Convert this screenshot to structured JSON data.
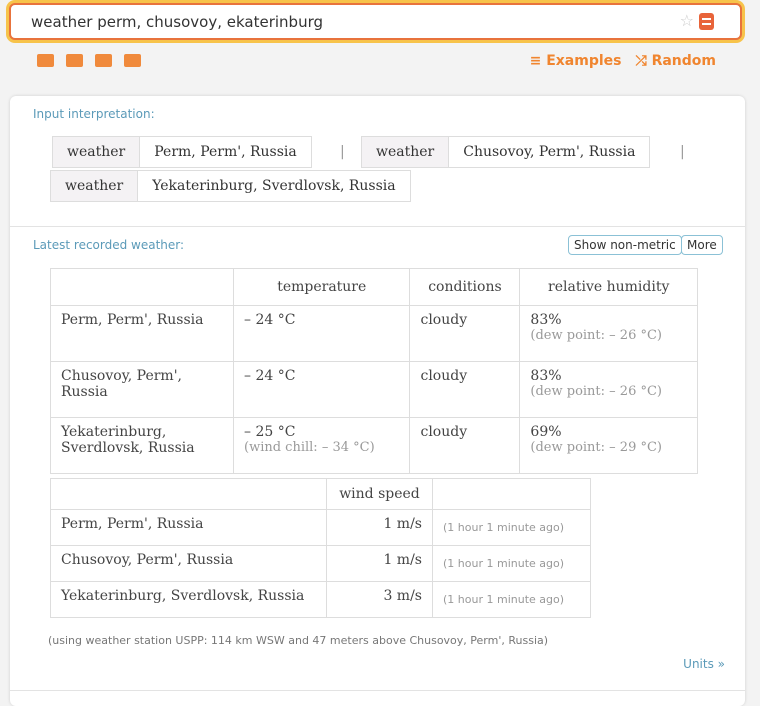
{
  "search": {
    "value": "weather perm, chusovoy, ekaterinburg"
  },
  "toolbar": {
    "examples": "≡ Examples",
    "random": "⤮ Random"
  },
  "interpretation": {
    "label": "Input interpretation:",
    "items": [
      {
        "k": "weather",
        "v": "Perm, Perm', Russia"
      },
      {
        "k": "weather",
        "v": "Chusovoy, Perm', Russia"
      },
      {
        "k": "weather",
        "v": "Yekaterinburg, Sverdlovsk, Russia"
      }
    ],
    "sep": "|"
  },
  "weather": {
    "label": "Latest recorded weather:",
    "show_non_metric": "Show non-metric",
    "more": "More",
    "headers": [
      "temperature",
      "conditions",
      "relative humidity"
    ],
    "rows": [
      {
        "place": "Perm, Perm', Russia",
        "temp": "– 24 °C",
        "temp_sub": "",
        "cond": "cloudy",
        "hum": "83%",
        "hum_sub": "(dew point: – 26 °C)"
      },
      {
        "place": "Chusovoy, Perm', Russia",
        "temp": "– 24 °C",
        "temp_sub": "",
        "cond": "cloudy",
        "hum": "83%",
        "hum_sub": "(dew point: – 26 °C)"
      },
      {
        "place": "Yekaterinburg, Sverdlovsk, Russia",
        "temp": "– 25 °C",
        "temp_sub": "(wind chill: – 34 °C)",
        "cond": "cloudy",
        "hum": "69%",
        "hum_sub": "(dew point: – 29 °C)"
      }
    ],
    "wind_header": "wind speed",
    "wind_rows": [
      {
        "place": "Perm, Perm', Russia",
        "speed": "1 m/s",
        "ago": "(1 hour 1 minute ago)"
      },
      {
        "place": "Chusovoy, Perm', Russia",
        "speed": "1 m/s",
        "ago": "(1 hour 1 minute ago)"
      },
      {
        "place": "Yekaterinburg, Sverdlovsk, Russia",
        "speed": "3 m/s",
        "ago": "(1 hour 1 minute ago)"
      }
    ],
    "note": "(using weather station USPP: 114 km  WSW and 47 meters above Chusovoy, Perm', Russia)",
    "units": "Units »"
  }
}
